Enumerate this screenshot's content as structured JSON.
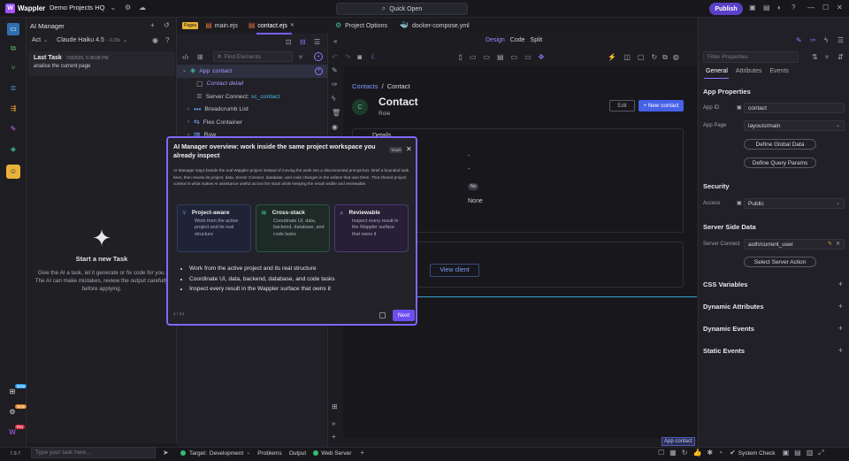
{
  "titlebar": {
    "app": "Wappler",
    "project": "Demo Projects HQ",
    "quick_open": "Quick Open",
    "publish": "Publish"
  },
  "ai": {
    "title": "AI Manager",
    "mode": "Act",
    "model": "Claude Haiku 4.5",
    "model_cost": "- 0.33x",
    "last_task_label": "Last Task",
    "last_task_date": "7/9/2026, 5:38:08 PM",
    "last_task_text": "analise the current page",
    "start_title": "Start a new Task",
    "start_desc": "Give the AI a task, let it generate or fix code for you. The AI can make mistakes, review the output carefully before applying.",
    "input_placeholder": "Type your task here...",
    "version": "7.9.7"
  },
  "tabs": {
    "pages": "Pages",
    "file1": "main.ejs",
    "file2": "contact.ejs",
    "file3": "Project Options",
    "file4": "docker-compose.yml"
  },
  "tree": {
    "search_placeholder": "Find Elements",
    "items": [
      {
        "label": "App",
        "extra": "contact"
      },
      {
        "label": "Contact detail"
      },
      {
        "label": "Server Connect:",
        "extra": "sc_contact"
      },
      {
        "label": "Breadcrumb List"
      },
      {
        "label": "Flex Container"
      },
      {
        "label": "Row"
      }
    ]
  },
  "view": {
    "design": "Design",
    "code": "Code",
    "split": "Split"
  },
  "page": {
    "crumb1": "Contacts",
    "crumb_sep": "/",
    "crumb2": "Contact",
    "avatar": "C",
    "heading": "Contact",
    "role": "Role",
    "edit": "Edit",
    "new": "+ New contact",
    "details": "Details",
    "dash1": "-",
    "dash2": "-",
    "no_badge": "No",
    "none": "None",
    "view_client": "View client",
    "app_tag": "App contact"
  },
  "tour": {
    "title": "AI Manager overview: work inside the same project workspace you already inspect",
    "badge": "TOUR",
    "desc": "AI Manager stays beside the real Wappler project instead of moving the work into a disconnected prompt box. Brief a bounded task here, then review its project, data, Server Connect, database, and code changes in the editors that own them. That shared project context is what makes AI assistance useful across the stack while keeping the result visible and reviewable.",
    "cards": [
      {
        "title": "Project-aware",
        "text": "Work from the active project and its real structure"
      },
      {
        "title": "Cross-stack",
        "text": "Coordinate UI, data, backend, database, and code tasks"
      },
      {
        "title": "Reviewable",
        "text": "Inspect every result in the Wappler surface that owns it"
      }
    ],
    "bullets": [
      "Work from the active project and its real structure",
      "Coordinate UI, data, backend, database, and code tasks",
      "Inspect every result in the Wappler surface that owns it"
    ],
    "progress": "1 / 14",
    "next": "Next"
  },
  "props": {
    "filter_placeholder": "Filter Properties",
    "tab_general": "General",
    "tab_attributes": "Attributes",
    "tab_events": "Events",
    "app_props": "App Properties",
    "app_id_label": "App ID",
    "app_id": "contact",
    "app_page_label": "App Page",
    "app_page": "layouts/main",
    "global_btn": "Define Global Data",
    "query_btn": "Define Query Params",
    "security": "Security",
    "access_label": "Access",
    "access": "Public",
    "ssd": "Server Side Data",
    "server_connect_label": "Server Connect",
    "server_connect": "auth/current_user",
    "action_btn": "Select Server Action",
    "sections": [
      "CSS Variables",
      "Dynamic Attributes",
      "Dynamic Events",
      "Static Events"
    ]
  },
  "status": {
    "target_label": "Target:",
    "target": "Development",
    "problems": "Problems",
    "output": "Output",
    "web_server": "Web Server",
    "system_check": "System Check",
    "badge_beta": "Beta",
    "badge_new": "New",
    "badge_pro": "Pro"
  },
  "colors": {
    "accent": "#7c5cff",
    "green": "#2fbf71",
    "panel": "#202026"
  }
}
